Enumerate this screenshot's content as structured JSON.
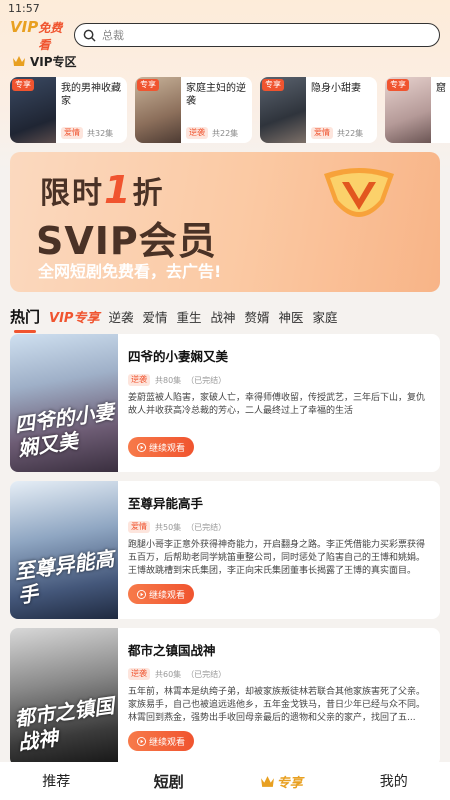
{
  "status_bar": {
    "time": "11:57"
  },
  "header": {
    "logo_vip": "VIP",
    "logo_text": "免费看",
    "search_placeholder": "总裁"
  },
  "vip_zone": {
    "title": "VIP专区",
    "items": [
      {
        "tag": "专享",
        "title": "我的男神收藏家",
        "category": "爱情",
        "episodes": "共32集"
      },
      {
        "tag": "专享",
        "title": "家庭主妇的逆袭",
        "category": "逆袭",
        "episodes": "共22集"
      },
      {
        "tag": "专享",
        "title": "隐身小甜妻",
        "category": "爱情",
        "episodes": "共22集"
      },
      {
        "tag": "专享",
        "title": "窟",
        "category": "",
        "episodes": ""
      }
    ]
  },
  "banner": {
    "line1_a": "限时",
    "line1_b": "1",
    "line1_c": "折",
    "line2": "SVIP会员",
    "line3": "全网短剧免费看，去广告!"
  },
  "tabs": [
    {
      "label": "热门",
      "active": true
    },
    {
      "label": "VIP专享",
      "vip": true
    },
    {
      "label": "逆袭"
    },
    {
      "label": "爱情"
    },
    {
      "label": "重生"
    },
    {
      "label": "战神"
    },
    {
      "label": "赘婿"
    },
    {
      "label": "神医"
    },
    {
      "label": "家庭"
    }
  ],
  "dramas": [
    {
      "title": "四爷的小妻娴又美",
      "category": "逆袭",
      "episodes": "共80集",
      "status": "（已完结）",
      "description": "姜蔚蓝被人陷害，家破人亡，幸得师傅收留，传授武艺，三年后下山，复仇故人并收获高冷总裁的芳心，二人最终过上了幸福的生活",
      "poster_text": "四爷的小妻娴又美",
      "play_label": "继续观看"
    },
    {
      "title": "至尊异能高手",
      "category": "爱情",
      "episodes": "共50集",
      "status": "（已完结）",
      "description": "跑腿小哥李正意外获得神奇能力，开启翻身之路。李正凭借能力买彩票获得五百万，后帮助老同学姚笛重整公司，同时惩处了陷害自己的王博和姚娟。王博故跳槽到宋氏集团，李正向宋氏集团董事长揭露了王博的真实面目。姚...",
      "poster_text": "至尊异能高手",
      "play_label": "继续观看"
    },
    {
      "title": "都市之镇国战神",
      "category": "逆袭",
      "episodes": "共60集",
      "status": "（已完结）",
      "description": "五年前，林霄本是纨绔子弟，却被家族叛徒林若联合其他家族害死了父亲。家族易手，自己也被追远逃他乡，五年金戈铁马，昔日少年已经与众不同。林霄回到燕金，强势出手收回母亲最后的遗物和父亲的家产，找回了五...",
      "poster_text": "都市之镇国战神",
      "play_label": "继续观看"
    }
  ],
  "bottom_nav": {
    "recommend": "推荐",
    "short_drama": "短剧",
    "vip": "专享",
    "mine": "我的"
  },
  "colors": {
    "accent": "#f0542f",
    "gold": "#e8a021",
    "banner_bg": "#fbc9a3"
  }
}
